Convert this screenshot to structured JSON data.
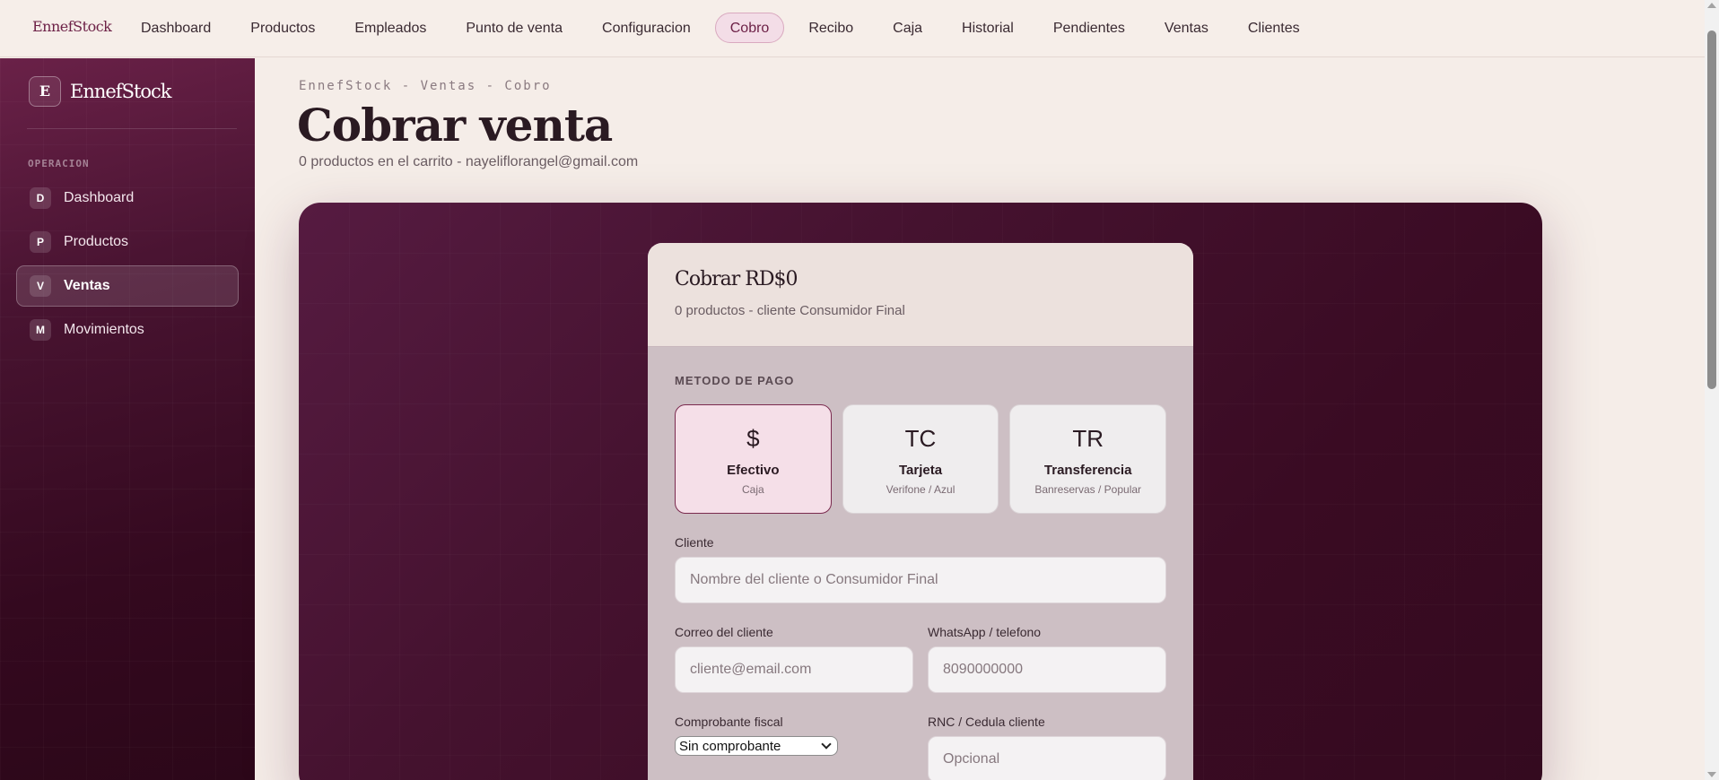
{
  "topnav": {
    "brand": "EnnefStock",
    "links": [
      "Dashboard",
      "Productos",
      "Empleados",
      "Punto de venta",
      "Configuracion",
      "Cobro",
      "Recibo",
      "Caja",
      "Historial",
      "Pendientes",
      "Ventas",
      "Clientes"
    ],
    "active": "Cobro"
  },
  "sidebar": {
    "logo_letter": "E",
    "brand": "EnnefStock",
    "section": "OPERACION",
    "items": [
      {
        "badge": "D",
        "label": "Dashboard"
      },
      {
        "badge": "P",
        "label": "Productos"
      },
      {
        "badge": "V",
        "label": "Ventas"
      },
      {
        "badge": "M",
        "label": "Movimientos"
      }
    ],
    "active": "Ventas"
  },
  "header": {
    "breadcrumb": "EnnefStock - Ventas - Cobro",
    "title": "Cobrar venta",
    "subtitle": "0 productos en el carrito - nayeliflorangel@gmail.com"
  },
  "card": {
    "title": "Cobrar RD$0",
    "subtitle": "0 productos - cliente Consumidor Final",
    "method_label": "METODO DE PAGO",
    "methods": [
      {
        "icon": "$",
        "name": "Efectivo",
        "desc": "Caja"
      },
      {
        "icon": "TC",
        "name": "Tarjeta",
        "desc": "Verifone / Azul"
      },
      {
        "icon": "TR",
        "name": "Transferencia",
        "desc": "Banreservas / Popular"
      }
    ],
    "selected_method": "Efectivo",
    "client_label": "Cliente",
    "client_placeholder": "Nombre del cliente o Consumidor Final",
    "email_label": "Correo del cliente",
    "email_placeholder": "cliente@email.com",
    "phone_label": "WhatsApp / telefono",
    "phone_placeholder": "8090000000",
    "fiscal_label": "Comprobante fiscal",
    "fiscal_value": "Sin comprobante",
    "rnc_label": "RNC / Cedula cliente",
    "rnc_placeholder": "Opcional"
  }
}
